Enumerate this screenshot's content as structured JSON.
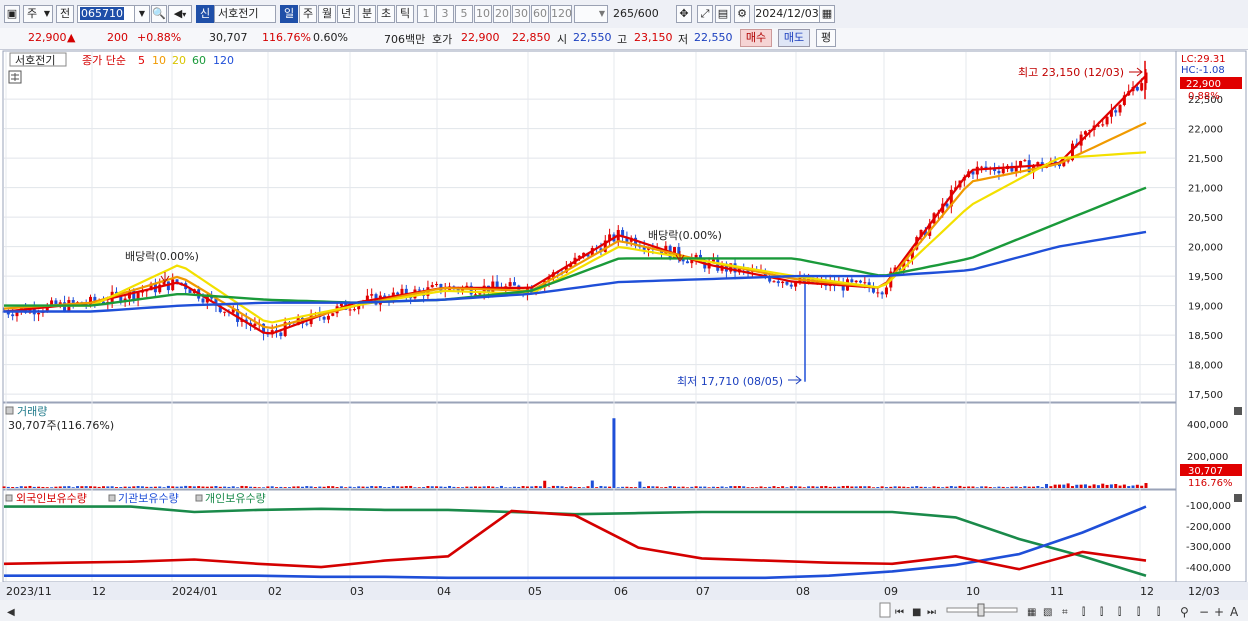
{
  "toolbar": {
    "market_label": "주",
    "prev_label": "전",
    "code": "065710",
    "speaker_arrow": "▾",
    "new_badge": "신",
    "stock_name": "서호전기",
    "periods": [
      "일",
      "주",
      "월",
      "년",
      "분",
      "초",
      "틱"
    ],
    "intervals": [
      "1",
      "3",
      "5",
      "10",
      "20",
      "30",
      "60",
      "120"
    ],
    "count_value": "265",
    "count_total": "/600",
    "date_value": "2024/12/03"
  },
  "quote": {
    "price": "22,900",
    "change_arrow": "▲",
    "change": "200",
    "change_pct": "+0.88%",
    "volume": "30,707",
    "volume_ratio": "116.76%",
    "turnover_pct": "0.60%",
    "amount": "706백만",
    "bid_label": "호가",
    "ask_price": "22,900",
    "bid_price": "22,850",
    "open_label": "시",
    "open": "22,550",
    "high_label": "고",
    "high": "23,150",
    "low_label": "저",
    "low": "22,550",
    "buy_button": "매수",
    "sell_button": "매도",
    "eval_button": "평"
  },
  "price_panel": {
    "stock_tag": "서호전기",
    "legend_main": "종가 단순",
    "ma_periods": [
      "5",
      "10",
      "20",
      "60",
      "120"
    ],
    "ma_colors": [
      "#e00000",
      "#f09a00",
      "#f3e000",
      "#1a9a3a",
      "#1f4fd8"
    ],
    "lc_label": "LC:29.31",
    "hc_label": "HC:-1.08",
    "current_tag": "22,900",
    "current_pct": "0.88%",
    "high_annotation": "최고 23,150 (12/03)",
    "low_annotation": "최저 17,710 (08/05)",
    "dividend1": "배당락(0.00%)",
    "dividend2": "배당락(0.00%)",
    "y_ticks": [
      "22,500",
      "22,000",
      "21,500",
      "21,000",
      "20,500",
      "20,000",
      "19,500",
      "19,000",
      "18,500",
      "18,000",
      "17,500"
    ]
  },
  "volume_panel": {
    "title": "거래량",
    "value_label": "30,707주(116.76%)",
    "y_ticks": [
      "400,000",
      "200,000"
    ],
    "current_tag": "30,707",
    "current_pct": "116.76%"
  },
  "holding_panel": {
    "legend": [
      "외국인보유수량",
      "기관보유수량",
      "개인보유수량"
    ],
    "legend_colors": [
      "#d40000",
      "#1f4fd8",
      "#1a8a4a"
    ],
    "y_ticks": [
      "-100,000",
      "-200,000",
      "-300,000",
      "-400,000"
    ]
  },
  "x_axis": {
    "labels": [
      "2023/11",
      "12",
      "2024/01",
      "02",
      "03",
      "04",
      "05",
      "06",
      "07",
      "08",
      "09",
      "10",
      "11",
      "12"
    ],
    "right_label": "12/03"
  },
  "chart_data": {
    "type": "line",
    "x": [
      "2023/11",
      "12",
      "2024/01",
      "02",
      "03",
      "04",
      "05",
      "06",
      "07",
      "08",
      "09",
      "10",
      "11",
      "12"
    ],
    "ylim": [
      17400,
      23300
    ],
    "series": [
      {
        "name": "5",
        "values": [
          18900,
          19050,
          19400,
          18500,
          19050,
          19300,
          19300,
          20200,
          19700,
          19400,
          19300,
          21300,
          21400,
          22900
        ]
      },
      {
        "name": "10",
        "values": [
          18950,
          19050,
          19500,
          18600,
          19000,
          19300,
          19250,
          20100,
          19750,
          19450,
          19300,
          21100,
          21400,
          22100
        ]
      },
      {
        "name": "20",
        "values": [
          19000,
          19000,
          19700,
          18700,
          19000,
          19250,
          19200,
          20000,
          19750,
          19500,
          19300,
          20700,
          21500,
          21600
        ]
      },
      {
        "name": "60",
        "values": [
          19000,
          19000,
          19200,
          19100,
          19050,
          19100,
          19250,
          19800,
          19800,
          19800,
          19500,
          19800,
          20400,
          21000
        ]
      },
      {
        "name": "120",
        "values": [
          18900,
          18900,
          19000,
          19050,
          19050,
          19100,
          19200,
          19400,
          19450,
          19500,
          19500,
          19600,
          20000,
          20250
        ]
      }
    ],
    "annotations": {
      "high": 23150,
      "low": 17710
    }
  }
}
